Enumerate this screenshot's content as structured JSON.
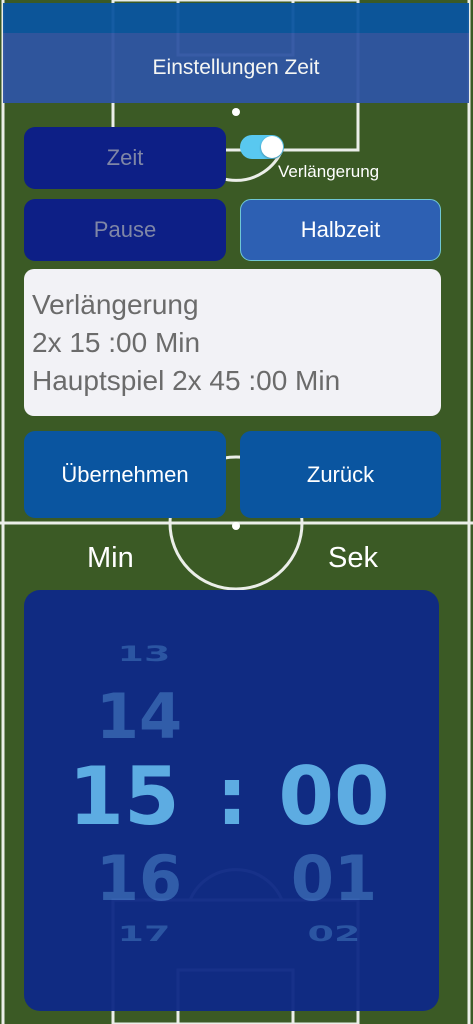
{
  "header": {
    "title": "Einstellungen Zeit"
  },
  "buttons": {
    "zeit": "Zeit",
    "pause": "Pause",
    "halbzeit": "Halbzeit",
    "uebernehmen": "Übernehmen",
    "zurueck": "Zurück"
  },
  "toggle": {
    "label": "Verlängerung",
    "on": true
  },
  "info": {
    "line1": "Verlängerung",
    "line2": "2x 15 :00 Min",
    "line3": "Hauptspiel 2x 45 :00 Min"
  },
  "picker": {
    "min_label": "Min",
    "sek_label": "Sek",
    "separator": ":",
    "min_above2": "13",
    "min_above1": "14",
    "min_selected": "15",
    "min_below1": "16",
    "min_below2": "17",
    "sek_selected": "00",
    "sek_below1": "01",
    "sek_below2": "02"
  },
  "colors": {
    "field": "#3b5a25",
    "header": "#2f55a3",
    "picker": "#0f2a86",
    "accent": "#59c8f0"
  }
}
